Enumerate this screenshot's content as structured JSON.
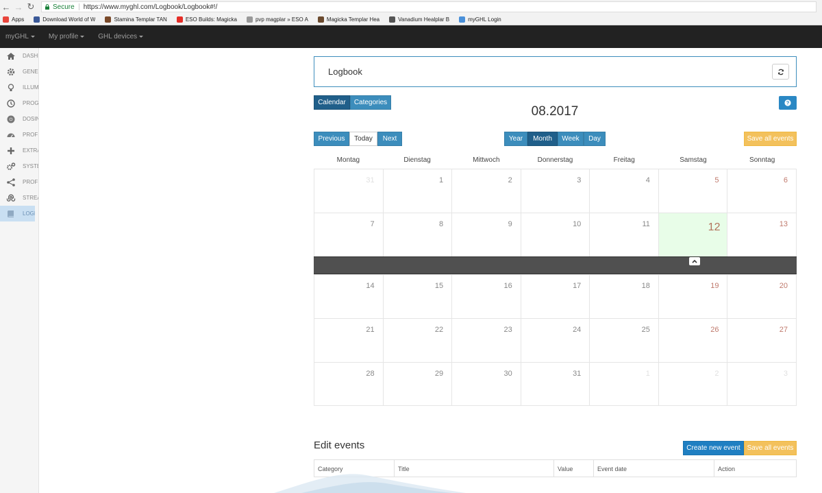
{
  "browser": {
    "secure_label": "Secure",
    "url": "https://www.myghl.com/Logbook/Logbook#!/"
  },
  "bookmarks": [
    {
      "label": "Apps",
      "color": "#e8453c"
    },
    {
      "label": "Download World of W",
      "color": "#3b5998"
    },
    {
      "label": "Stamina Templar TAN",
      "color": "#7a4a2a"
    },
    {
      "label": "ESO Builds: Magicka",
      "color": "#e52d27"
    },
    {
      "label": "pvp magplar » ESO A",
      "color": "#999999"
    },
    {
      "label": "Magicka Templar Hea",
      "color": "#6b4a2e"
    },
    {
      "label": "Vanadium Healplar B",
      "color": "#555555"
    },
    {
      "label": "myGHL Login",
      "color": "#4a90d9"
    }
  ],
  "appnav": {
    "items": [
      "myGHL",
      "My profile",
      "GHL devices"
    ]
  },
  "sidebar": {
    "items": [
      {
        "label": "DASHBOARD",
        "icon": "home-icon"
      },
      {
        "label": "GENERAL",
        "icon": "gear-icon"
      },
      {
        "label": "ILLUMINATION",
        "icon": "bulb-icon"
      },
      {
        "label": "PROGRAM",
        "icon": "clock-icon"
      },
      {
        "label": "DOSING",
        "icon": "chrome-icon"
      },
      {
        "label": "PROFILES",
        "icon": "dashboard-icon"
      },
      {
        "label": "EXTRAS",
        "icon": "plus-icon"
      },
      {
        "label": "SYSTEM",
        "icon": "gears-icon"
      },
      {
        "label": "PROFILILUX",
        "icon": "share-icon"
      },
      {
        "label": "STREAM",
        "icon": "stumble-icon"
      },
      {
        "label": "LOGBOOK",
        "icon": "book-icon"
      }
    ],
    "active_index": 10
  },
  "panel": {
    "title": "Logbook"
  },
  "view_tabs": {
    "calendar": "Calendar",
    "categories": "Categories"
  },
  "calendar": {
    "title": "08.2017",
    "nav": {
      "previous": "Previous",
      "today": "Today",
      "next": "Next"
    },
    "views": {
      "year": "Year",
      "month": "Month",
      "week": "Week",
      "day": "Day"
    },
    "save_all": "Save all events",
    "weekdays": [
      "Montag",
      "Dienstag",
      "Mittwoch",
      "Donnerstag",
      "Freitag",
      "Samstag",
      "Sonntag"
    ],
    "weeks": [
      [
        {
          "d": "31",
          "m": true
        },
        {
          "d": "1"
        },
        {
          "d": "2"
        },
        {
          "d": "3"
        },
        {
          "d": "4"
        },
        {
          "d": "5",
          "w": true
        },
        {
          "d": "6",
          "w": true
        }
      ],
      [
        {
          "d": "7"
        },
        {
          "d": "8"
        },
        {
          "d": "9"
        },
        {
          "d": "10"
        },
        {
          "d": "11"
        },
        {
          "d": "12",
          "w": true,
          "t": true
        },
        {
          "d": "13",
          "w": true
        }
      ],
      [
        {
          "d": "14"
        },
        {
          "d": "15"
        },
        {
          "d": "16"
        },
        {
          "d": "17"
        },
        {
          "d": "18"
        },
        {
          "d": "19",
          "w": true
        },
        {
          "d": "20",
          "w": true
        }
      ],
      [
        {
          "d": "21"
        },
        {
          "d": "22"
        },
        {
          "d": "23"
        },
        {
          "d": "24"
        },
        {
          "d": "25"
        },
        {
          "d": "26",
          "w": true
        },
        {
          "d": "27",
          "w": true
        }
      ],
      [
        {
          "d": "28"
        },
        {
          "d": "29"
        },
        {
          "d": "30"
        },
        {
          "d": "31"
        },
        {
          "d": "1",
          "m": true
        },
        {
          "d": "2",
          "m": true
        },
        {
          "d": "3",
          "m": true
        }
      ]
    ]
  },
  "edit_events": {
    "title": "Edit events",
    "create_label": "Create new event",
    "save_label": "Save all events",
    "columns": [
      "Category",
      "Title",
      "Value",
      "Event date",
      "Action"
    ]
  }
}
